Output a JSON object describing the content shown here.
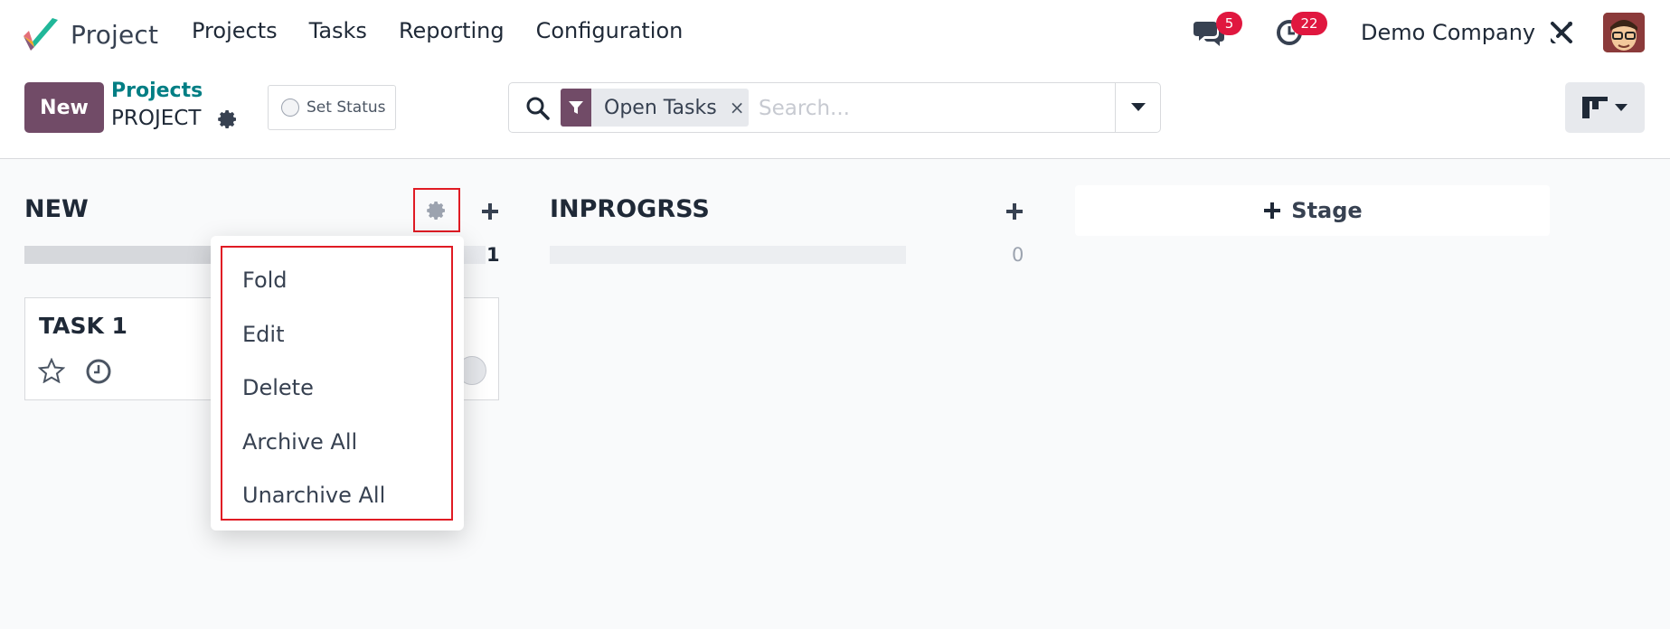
{
  "app": {
    "name": "Project"
  },
  "nav": {
    "items": [
      {
        "label": "Projects"
      },
      {
        "label": "Tasks"
      },
      {
        "label": "Reporting"
      },
      {
        "label": "Configuration"
      }
    ]
  },
  "systray": {
    "messages_count": "5",
    "activities_count": "22",
    "company": "Demo Company"
  },
  "control_panel": {
    "new_label": "New",
    "breadcrumb_parent": "Projects",
    "breadcrumb_current": "PROJECT",
    "set_status_label": "Set Status",
    "search": {
      "facet_label": "Open Tasks",
      "facet_remove": "×",
      "placeholder": "Search..."
    }
  },
  "kanban": {
    "columns": [
      {
        "title": "NEW",
        "count": "1",
        "progress": 0.5
      },
      {
        "title": "INPROGRSS",
        "count": "0",
        "progress": 0
      }
    ],
    "task": {
      "title": "TASK 1"
    },
    "add_stage_label": "Stage"
  },
  "column_menu": {
    "items": [
      {
        "label": "Fold"
      },
      {
        "label": "Edit"
      },
      {
        "label": "Delete"
      },
      {
        "label": "Archive All"
      },
      {
        "label": "Unarchive All"
      }
    ]
  },
  "colors": {
    "brand": "#714b67",
    "link": "#017e84",
    "badge": "#e0173f",
    "highlight": "#e01b24"
  }
}
